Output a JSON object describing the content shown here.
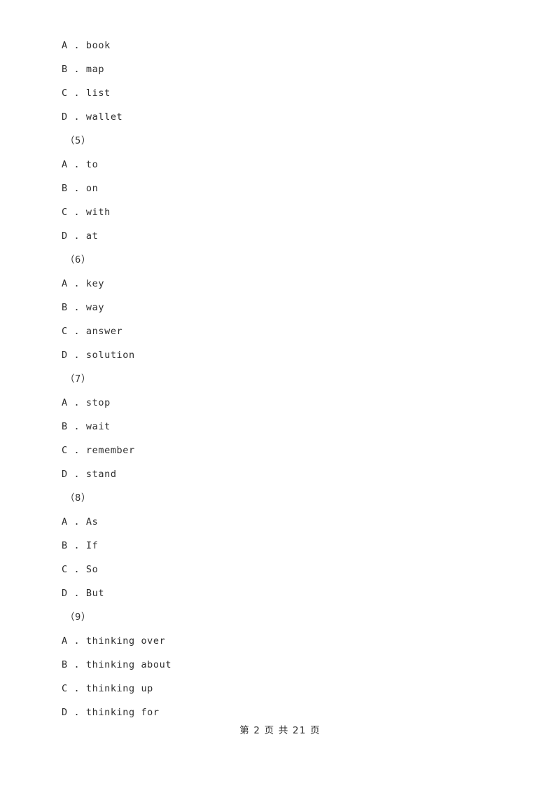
{
  "document": {
    "page_background": "#ffffff",
    "text_color": "#2f2f2f"
  },
  "body_lines": [
    {
      "kind": "option",
      "text": "A . book"
    },
    {
      "kind": "option",
      "text": "B . map"
    },
    {
      "kind": "option",
      "text": "C . list"
    },
    {
      "kind": "option",
      "text": "D . wallet"
    },
    {
      "kind": "qnum",
      "text": "（5）"
    },
    {
      "kind": "option",
      "text": "A . to"
    },
    {
      "kind": "option",
      "text": "B . on"
    },
    {
      "kind": "option",
      "text": "C . with"
    },
    {
      "kind": "option",
      "text": "D . at"
    },
    {
      "kind": "qnum",
      "text": "（6）"
    },
    {
      "kind": "option",
      "text": "A . key"
    },
    {
      "kind": "option",
      "text": "B . way"
    },
    {
      "kind": "option",
      "text": "C . answer"
    },
    {
      "kind": "option",
      "text": "D . solution"
    },
    {
      "kind": "qnum",
      "text": "（7）"
    },
    {
      "kind": "option",
      "text": "A . stop"
    },
    {
      "kind": "option",
      "text": "B . wait"
    },
    {
      "kind": "option",
      "text": "C . remember"
    },
    {
      "kind": "option",
      "text": "D . stand"
    },
    {
      "kind": "qnum",
      "text": "（8）"
    },
    {
      "kind": "option",
      "text": "A . As"
    },
    {
      "kind": "option",
      "text": "B . If"
    },
    {
      "kind": "option",
      "text": "C . So"
    },
    {
      "kind": "option",
      "text": "D . But"
    },
    {
      "kind": "qnum",
      "text": "（9）"
    },
    {
      "kind": "option",
      "text": "A . thinking over"
    },
    {
      "kind": "option",
      "text": "B . thinking about"
    },
    {
      "kind": "option",
      "text": "C . thinking up"
    },
    {
      "kind": "option",
      "text": "D . thinking for"
    }
  ],
  "footer": {
    "text": "第 2 页 共 21 页",
    "current_page": "2",
    "total_pages": "21"
  }
}
